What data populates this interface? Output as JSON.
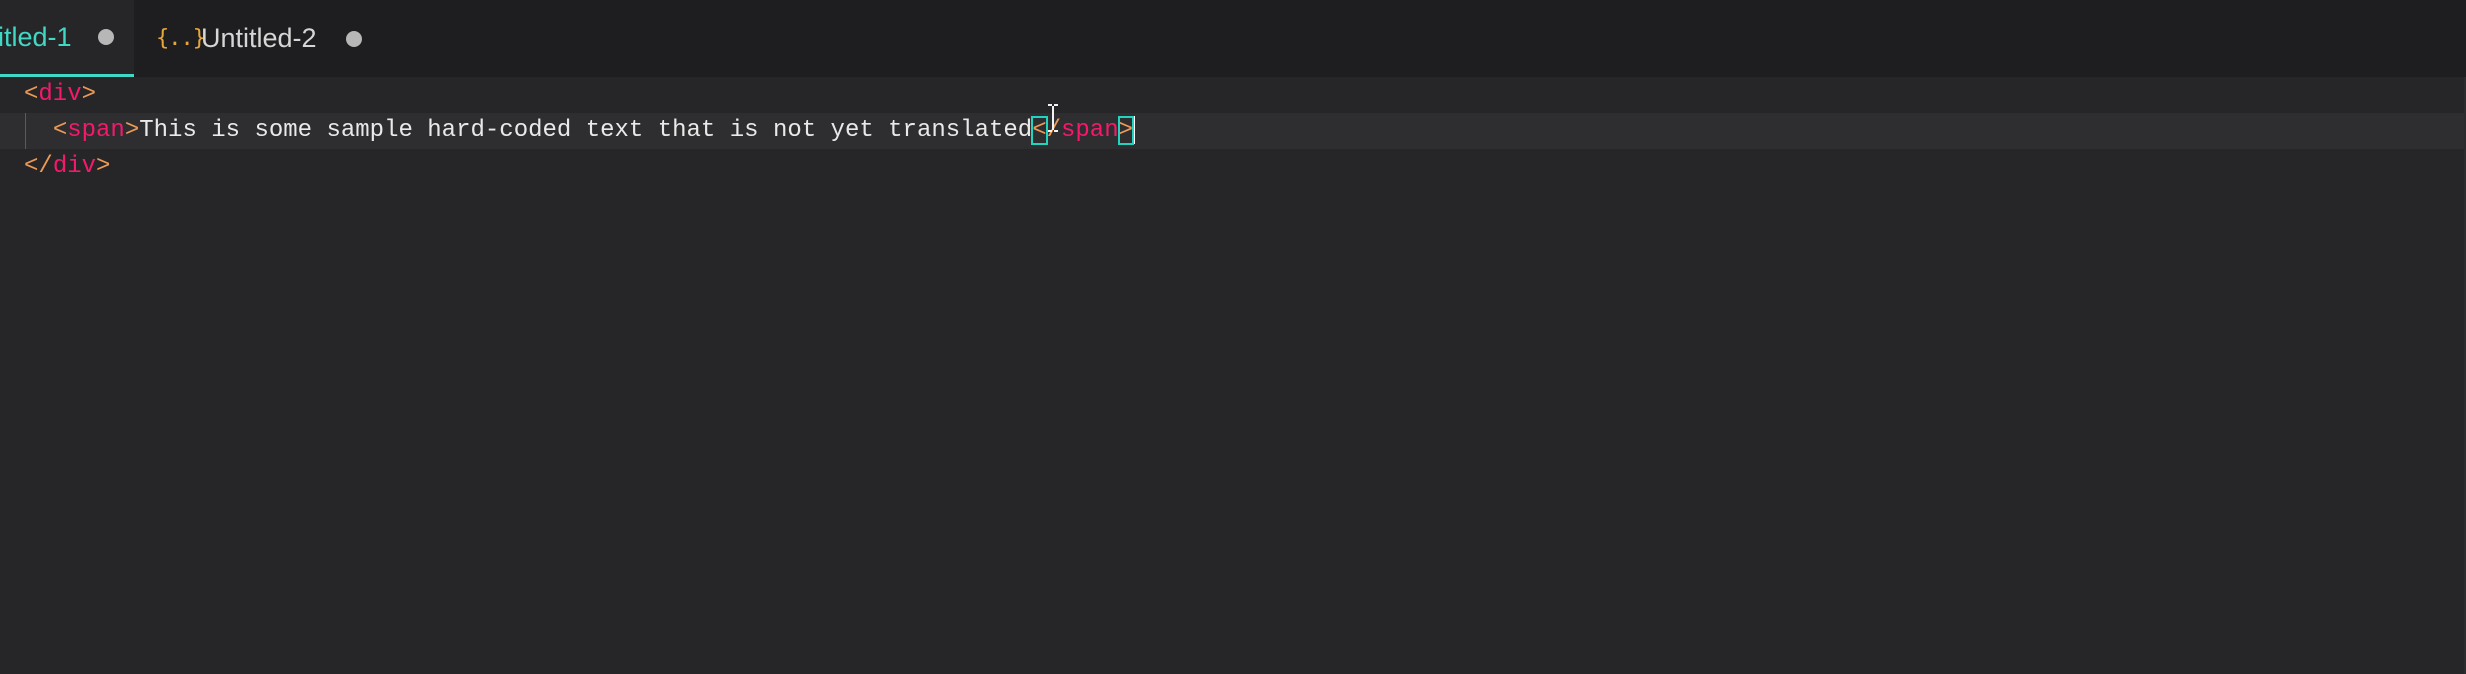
{
  "tabs": [
    {
      "label": "itled-1",
      "modified": true,
      "active": true
    },
    {
      "icon": "json-braces-icon",
      "icon_glyph": "{..}",
      "label": "Untitled-2",
      "modified": true,
      "active": false
    }
  ],
  "editor": {
    "lines": [
      {
        "open": "<",
        "tag": "div",
        "close": ">"
      },
      {
        "indent": "  ",
        "open": "<",
        "tag": "span",
        "close": ">",
        "text": "This is some sample hard-coded text that is not yet translated",
        "end_open": "<",
        "end_slash": "/",
        "end_tag": "span",
        "end_close": ">"
      },
      {
        "open": "</",
        "tag": "div",
        "close": ">"
      }
    ]
  },
  "colors": {
    "background": "#262629",
    "tabbar": "#1e1e20",
    "accent": "#3fd9c5",
    "tag": "#f4196b",
    "punctuation": "#ec9a55",
    "bracket_match": "#22d3c0",
    "text": "#e9e9e9"
  }
}
